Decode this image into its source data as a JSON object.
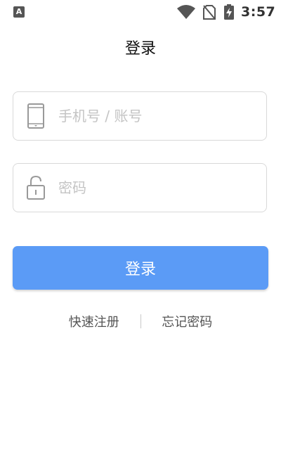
{
  "status_bar": {
    "notification_icon": "A",
    "wifi_icon": "wifi-icon",
    "sim_icon": "no-sim-icon",
    "battery_icon": "battery-charging-icon",
    "time": "3:57"
  },
  "header": {
    "title": "登录"
  },
  "form": {
    "phone": {
      "icon": "phone-icon",
      "placeholder": "手机号 / 账号",
      "value": ""
    },
    "password": {
      "icon": "lock-icon",
      "placeholder": "密码",
      "value": ""
    },
    "login_label": "登录"
  },
  "links": {
    "register": "快速注册",
    "separator": "|",
    "forgot": "忘记密码"
  },
  "colors": {
    "primary": "#5b9bf6",
    "border": "#d9d9d9",
    "placeholder": "#c4c4c4",
    "link_text": "#555555"
  }
}
